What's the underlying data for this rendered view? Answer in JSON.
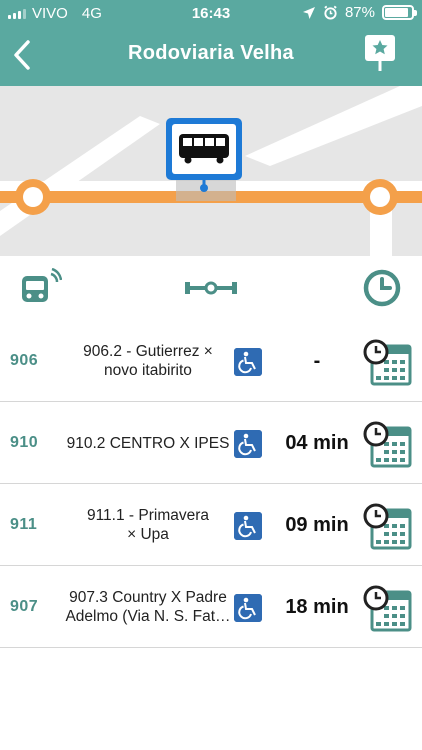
{
  "status": {
    "carrier": "VIVO",
    "network": "4G",
    "time": "16:43",
    "battery": "87%",
    "battery_level": 0.87
  },
  "nav": {
    "title": "Rodoviaria Velha",
    "back_icon": "chevron-left-icon",
    "favorite_icon": "star-pin-icon"
  },
  "header_icons": {
    "realtime": "bus-realtime-icon",
    "route": "route-icon",
    "schedule": "clock-icon"
  },
  "lines": [
    {
      "code": "906",
      "name_line1": "906.2 - Gutierrez ×",
      "name_line2": "novo itabirito",
      "eta": "-"
    },
    {
      "code": "910",
      "name_line1": "910.2 CENTRO X IPES",
      "name_line2": "",
      "eta": "04 min"
    },
    {
      "code": "911",
      "name_line1": "911.1 - Primavera",
      "name_line2": "× Upa",
      "eta": "09 min"
    },
    {
      "code": "907",
      "name_line1": "907.3 Country X Padre",
      "name_line2": "Adelmo (Via N. S. Fat…",
      "eta": "18 min"
    }
  ],
  "colors": {
    "primary": "#5aa9a0",
    "accent": "#4b8f87",
    "route_line": "#f4a04a",
    "stop_blue": "#1e7ad6",
    "access_blue": "#2f6bb3"
  }
}
